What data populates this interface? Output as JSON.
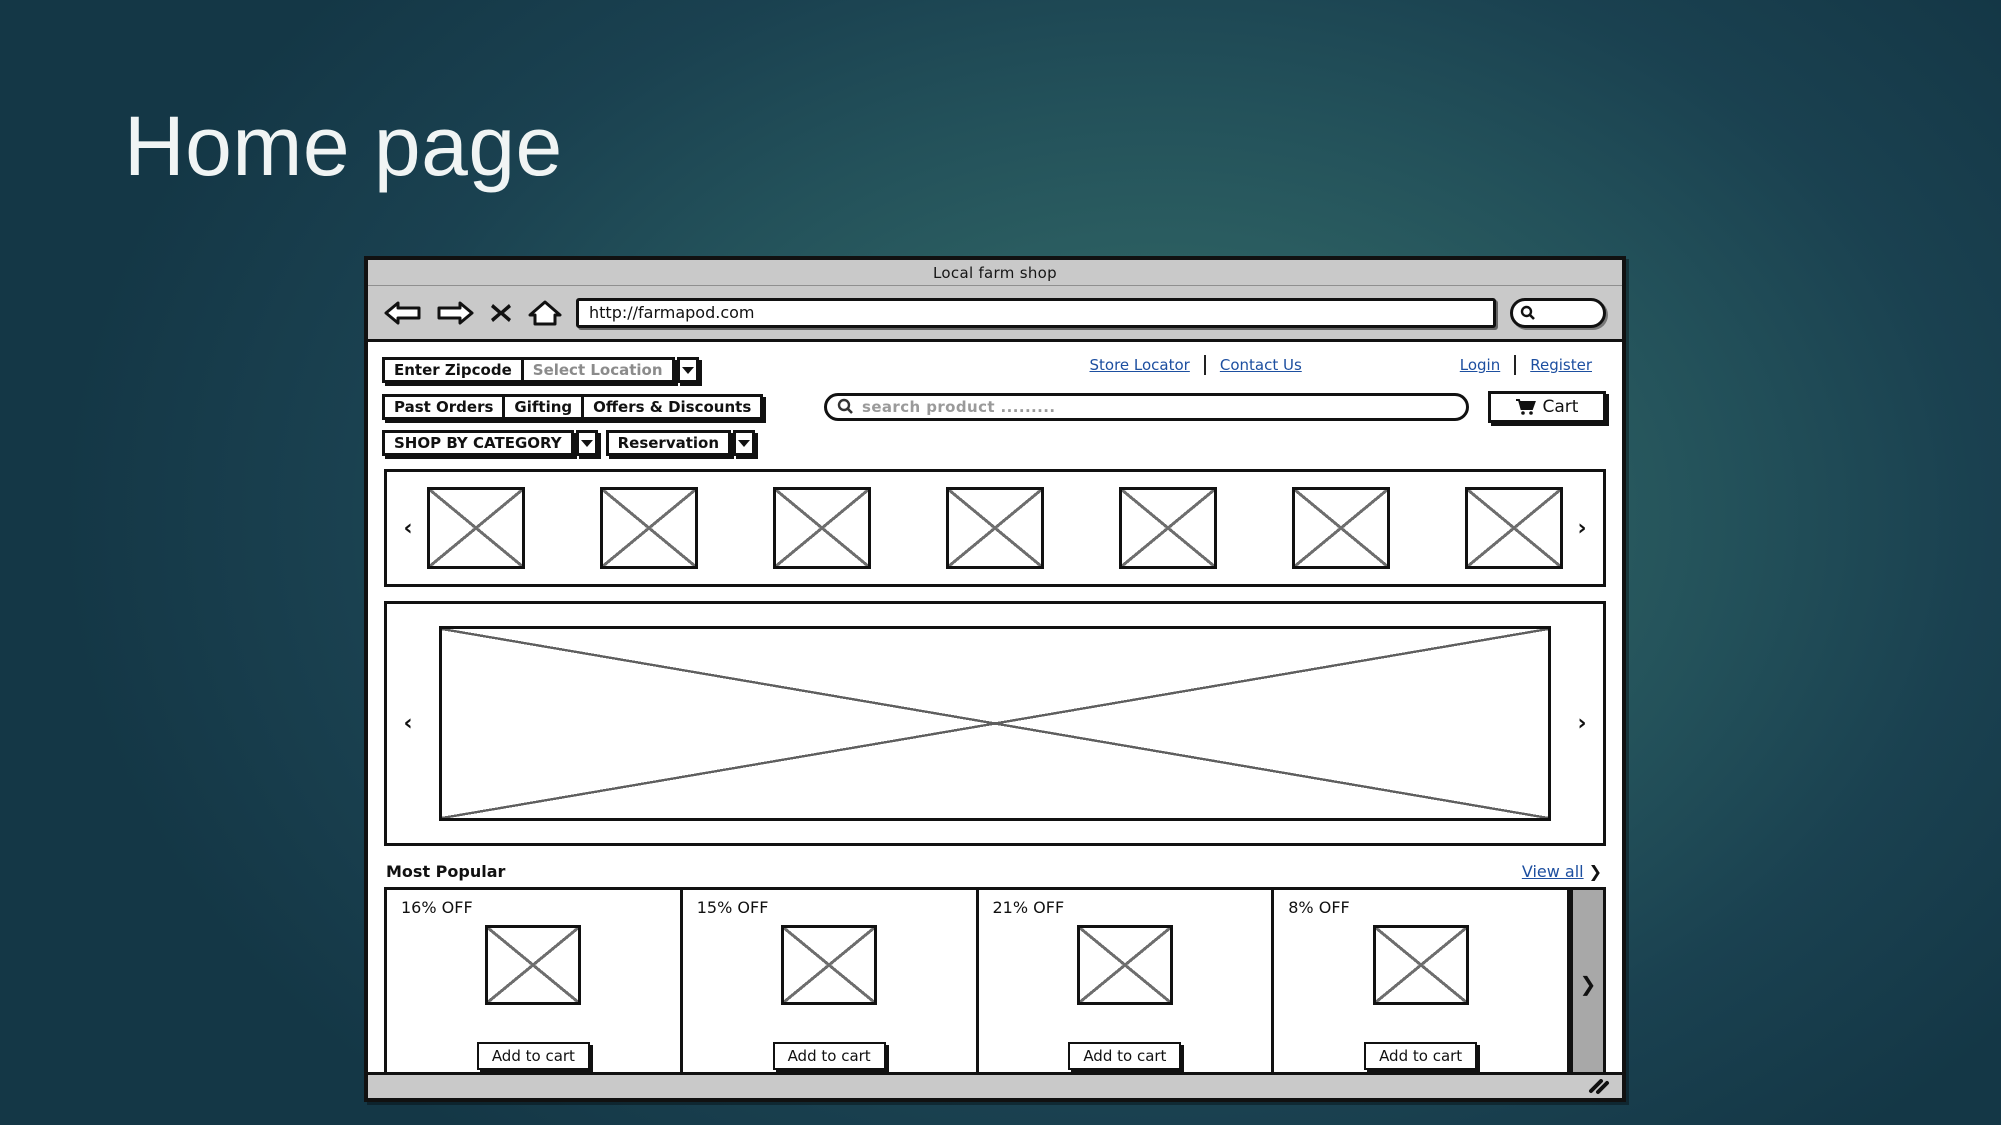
{
  "slide": {
    "title": "Home page",
    "background_color": "#1a4150",
    "title_color": "#f0f4f4"
  },
  "browser": {
    "window_title": "Local farm shop",
    "url_value": "http://farmapod.com",
    "nav_icons": [
      {
        "name": "back-arrow-icon",
        "label": "Back"
      },
      {
        "name": "forward-arrow-icon",
        "label": "Forward"
      },
      {
        "name": "close-x-icon",
        "label": "Stop"
      },
      {
        "name": "home-icon",
        "label": "Home"
      }
    ],
    "browser_search": {
      "icon": "search-icon",
      "value": ""
    },
    "status_bar": {
      "resize_grip_icon": "resize-grip-icon"
    }
  },
  "site": {
    "zipcode_button": "Enter Zipcode",
    "location_select": "Select Location",
    "quick_links": [
      "Past Orders",
      "Gifting",
      "Offers & Discounts"
    ],
    "account_links": [
      "Store Locator",
      "Contact Us",
      "Login",
      "Register"
    ],
    "search": {
      "placeholder": "search product .........",
      "icon": "search-icon"
    },
    "cart_button": {
      "label": "Cart",
      "icon": "shopping-cart-icon"
    },
    "category_dropdown": "SHOP BY CATEGORY",
    "reservation_dropdown": "Reservation"
  },
  "carousel": {
    "prev_arrow": "‹",
    "next_arrow": "›",
    "thumbnails": [
      {
        "alt": "image-placeholder-1"
      },
      {
        "alt": "image-placeholder-2"
      },
      {
        "alt": "image-placeholder-3"
      },
      {
        "alt": "image-placeholder-4"
      },
      {
        "alt": "image-placeholder-5"
      },
      {
        "alt": "image-placeholder-6"
      },
      {
        "alt": "image-placeholder-7"
      }
    ]
  },
  "hero": {
    "prev_arrow": "‹",
    "next_arrow": "›",
    "image_alt": "hero-image-placeholder"
  },
  "most_popular": {
    "heading": "Most Popular",
    "view_all_label": "View all",
    "view_all_chevron": "❯",
    "scroll_next": "❯",
    "products": [
      {
        "discount": "16% OFF",
        "add_to_cart": "Add to cart",
        "image_alt": "product-image-placeholder"
      },
      {
        "discount": "15% OFF",
        "add_to_cart": "Add to cart",
        "image_alt": "product-image-placeholder"
      },
      {
        "discount": "21% OFF",
        "add_to_cart": "Add to cart",
        "image_alt": "product-image-placeholder"
      },
      {
        "discount": "8% OFF",
        "add_to_cart": "Add to cart",
        "image_alt": "product-image-placeholder"
      }
    ]
  }
}
